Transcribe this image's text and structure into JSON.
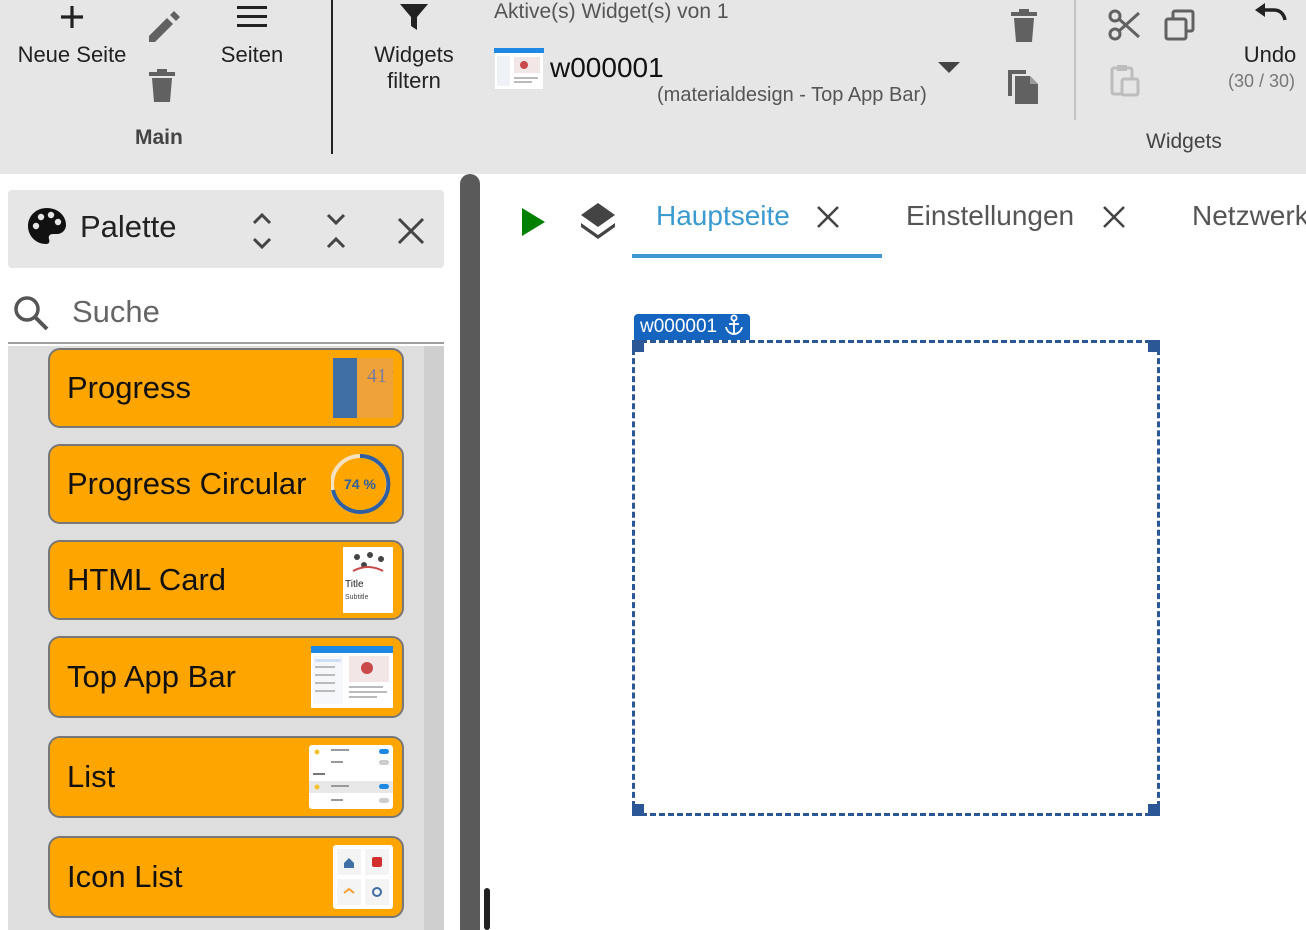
{
  "toolbar": {
    "main": {
      "new_page": "Neue Seite",
      "pages": "Seiten",
      "group_label": "Main"
    },
    "filter": {
      "label_line1": "Widgets",
      "label_line2": "filtern"
    },
    "active": {
      "header": "Aktive(s) Widget(s) von 1",
      "widget_id": "w000001",
      "widget_type": "(materialdesign - Top App Bar)"
    },
    "widgets": {
      "undo_label": "Undo",
      "undo_count": "(30 / 30)",
      "group_label": "Widgets"
    }
  },
  "palette": {
    "title": "Palette",
    "search_placeholder": "Suche",
    "items": [
      {
        "label": "Progress",
        "thumb": "progress-bar",
        "thumb_value": "41 %"
      },
      {
        "label": "Progress Circular",
        "thumb": "progress-circle",
        "thumb_value": "74 %"
      },
      {
        "label": "HTML Card",
        "thumb": "html-card",
        "thumb_title": "Title",
        "thumb_sub": "Subtitle"
      },
      {
        "label": "Top App Bar",
        "thumb": "top-app-bar"
      },
      {
        "label": "List",
        "thumb": "list"
      },
      {
        "label": "Icon List",
        "thumb": "icon-list"
      }
    ]
  },
  "editor": {
    "tabs": [
      {
        "label": "Hauptseite",
        "active": true
      },
      {
        "label": "Einstellungen",
        "active": false
      },
      {
        "label": "Netzwerk",
        "active": false
      }
    ],
    "widget": {
      "id": "w000001"
    }
  },
  "colors": {
    "accent": "#3b9bd1",
    "palette_item": "#ffa500",
    "selection": "#2b5797",
    "play": "#008000"
  }
}
